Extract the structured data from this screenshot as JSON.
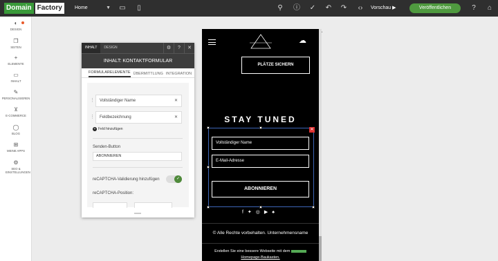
{
  "app": {
    "brand_part1": "Domain",
    "brand_part2": "Factory"
  },
  "toolbar": {
    "page_select": "Home",
    "preview_label": "Vorschau",
    "publish_label": "Veröffentlichen",
    "icons": [
      "desktop-icon",
      "mobile-icon",
      "search-icon",
      "info-icon",
      "check-icon",
      "undo-icon",
      "redo-icon",
      "code-icon",
      "help-icon",
      "home-icon"
    ]
  },
  "sidebar": {
    "items": [
      {
        "label": "DESIGN",
        "icon": "palette-icon"
      },
      {
        "label": "SEITEN",
        "icon": "pages-icon"
      },
      {
        "label": "ELEMENTE",
        "icon": "plus-icon"
      },
      {
        "label": "INHALT",
        "icon": "folder-icon"
      },
      {
        "label": "PERSONALISIEREN",
        "icon": "personalize-icon"
      },
      {
        "label": "E-COMMERCE",
        "icon": "cart-icon"
      },
      {
        "label": "BLOG",
        "icon": "blog-icon"
      },
      {
        "label": "MEINE APPS",
        "icon": "apps-icon"
      },
      {
        "label": "SEO & EINSTELLUNGEN",
        "icon": "settings-icon"
      }
    ]
  },
  "panel": {
    "tabs": [
      "INHALT",
      "DESIGN"
    ],
    "title": "INHALT: KONTAKTFORMULAR",
    "subtabs": [
      "FORMULARELEMENTE",
      "ÜBERMITTLUNG",
      "INTEGRATION"
    ],
    "fields": [
      "Vollständiger Name",
      "Feldbezeichnung"
    ],
    "add_field": "Feld hinzufügen",
    "submit_label": "Senden-Button",
    "submit_value": "ABONNIEREN",
    "recaptcha_label": "reCAPTCHA-Validierung hinzufügen",
    "recaptcha_enabled": true,
    "recaptcha_position_label": "reCAPTCHA-Position:"
  },
  "preview": {
    "cta": "PLÄTZE SICHERN",
    "heading": "STAY TUNED",
    "input_name": "Vollständiger Name",
    "input_email": "E-Mail-Adresse",
    "submit": "ABONNIEREN",
    "social_icons": [
      "facebook-icon",
      "twitter-icon",
      "instagram-icon",
      "youtube-icon",
      "snapchat-icon"
    ],
    "copyright": "© Alle Rechte vorbehalten.  Unternehmensname",
    "promo_line1": "Erstellen Sie eine bessere Webseite mit dem",
    "promo_line2": "Homepage-Baukasten."
  }
}
